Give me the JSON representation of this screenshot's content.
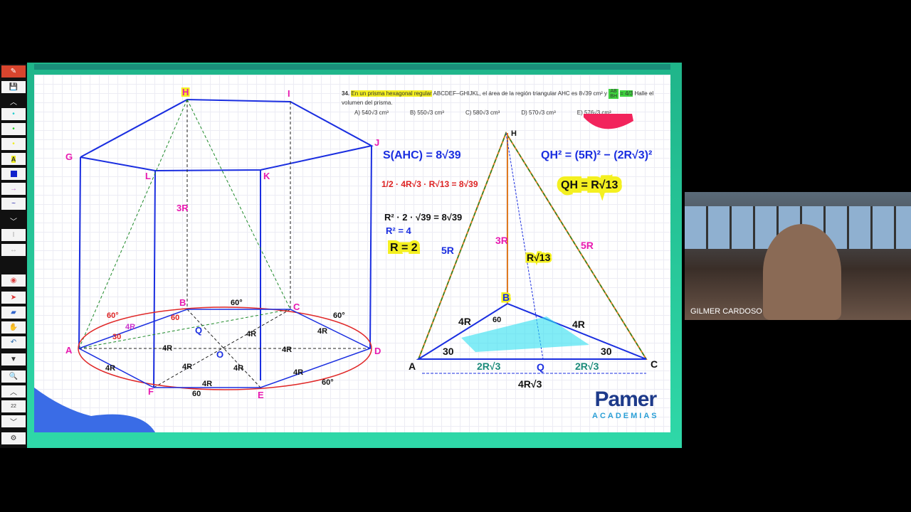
{
  "toolbar": {
    "page_number": "22",
    "tools": [
      "pen-menu",
      "save",
      "collapse-up",
      "pen-cyan",
      "pen-green",
      "highlighter-yellow",
      "text-tool",
      "square-tool",
      "arrow-tool",
      "freehand-tool",
      "collapse-down",
      "spotlight",
      "expand-width",
      "record",
      "pointer",
      "eraser",
      "hand",
      "undo",
      "dropdown",
      "zoom",
      "prev-page",
      "next-page",
      "settings"
    ]
  },
  "problem": {
    "number": "34.",
    "highlight": "En un prisma hexagonal regular",
    "text": "ABCDEF–GHIJKL, el área de la región triangular AHC es 8√39 cm² y",
    "frac_num": "AB",
    "frac_den": "BH",
    "frac_val": "= 4/3",
    "text2": "Halle el volumen del prisma.",
    "options": [
      "A) 540√3 cm³",
      "B) 550√3 cm³",
      "C) 580√3 cm³",
      "D) 570√3 cm³",
      "E) 576√3 cm³"
    ]
  },
  "prism": {
    "vertices": [
      "H",
      "I",
      "J",
      "G",
      "L",
      "K",
      "A",
      "B",
      "C",
      "D",
      "E",
      "F",
      "O",
      "Q"
    ],
    "labels": [
      "3R",
      "60°",
      "60°",
      "60°",
      "60°",
      "60",
      "4R",
      "4R",
      "4R",
      "4R",
      "4R",
      "4R",
      "4R",
      "4R",
      "4R",
      "4R",
      "30",
      "60"
    ]
  },
  "work": {
    "line1": "S(AHC) = 8√39",
    "line2": "1/2 · 4R√3 · R√13 = 8√39",
    "line3": "R² · 2 · √39 = 8√39",
    "line4": "R² = 4",
    "line5": "R = 2",
    "eq1": "QH² = (5R)² − (2R√3)²",
    "eq2": "QH = R√13"
  },
  "triangle": {
    "vertices": {
      "a": "A",
      "c": "C",
      "h": "H",
      "b": "B",
      "q": "Q"
    },
    "sides": {
      "left": "5R",
      "right": "5R",
      "height": "3R",
      "qh": "R√13",
      "ab": "4R",
      "bc": "4R",
      "aq": "2R√3",
      "qc": "2R√3",
      "ac": "4R√3"
    },
    "angles": {
      "a": "30",
      "c": "30",
      "b": "60"
    }
  },
  "logo": {
    "name": "Pamer",
    "sub": "ACADEMIAS"
  },
  "webcam": {
    "name": "GILMER CARDOSO"
  }
}
